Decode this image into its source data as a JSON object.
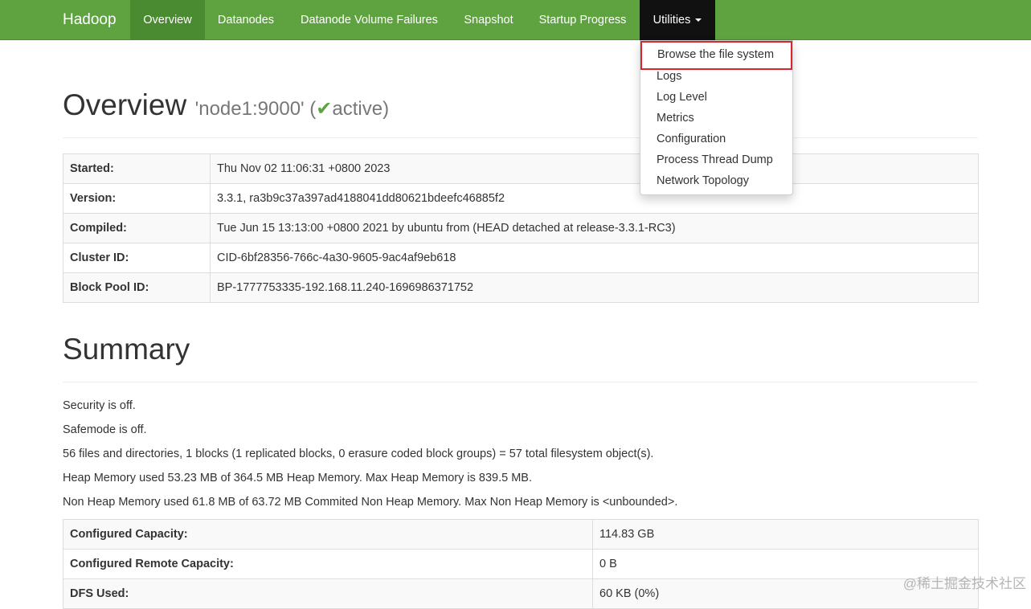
{
  "navbar": {
    "brand": "Hadoop",
    "items": [
      {
        "label": "Overview"
      },
      {
        "label": "Datanodes"
      },
      {
        "label": "Datanode Volume Failures"
      },
      {
        "label": "Snapshot"
      },
      {
        "label": "Startup Progress"
      },
      {
        "label": "Utilities"
      }
    ]
  },
  "dropdown": {
    "items": [
      {
        "label": "Browse the file system"
      },
      {
        "label": "Logs"
      },
      {
        "label": "Log Level"
      },
      {
        "label": "Metrics"
      },
      {
        "label": "Configuration"
      },
      {
        "label": "Process Thread Dump"
      },
      {
        "label": "Network Topology"
      }
    ]
  },
  "overview": {
    "title": "Overview",
    "node_prefix": "'node1:9000' (",
    "check_glyph": "✔",
    "status": "active",
    "status_suffix": ")",
    "rows": [
      {
        "key": "Started:",
        "value": "Thu Nov 02 11:06:31 +0800 2023"
      },
      {
        "key": "Version:",
        "value": "3.3.1, ra3b9c37a397ad4188041dd80621bdeefc46885f2"
      },
      {
        "key": "Compiled:",
        "value": "Tue Jun 15 13:13:00 +0800 2021 by ubuntu from (HEAD detached at release-3.3.1-RC3)"
      },
      {
        "key": "Cluster ID:",
        "value": "CID-6bf28356-766c-4a30-9605-9ac4af9eb618"
      },
      {
        "key": "Block Pool ID:",
        "value": "BP-1777753335-192.168.11.240-1696986371752"
      }
    ]
  },
  "summary": {
    "title": "Summary",
    "lines": [
      "Security is off.",
      "Safemode is off.",
      "56 files and directories, 1 blocks (1 replicated blocks, 0 erasure coded block groups) = 57 total filesystem object(s).",
      "Heap Memory used 53.23 MB of 364.5 MB Heap Memory. Max Heap Memory is 839.5 MB.",
      "Non Heap Memory used 61.8 MB of 63.72 MB Commited Non Heap Memory. Max Non Heap Memory is <unbounded>."
    ],
    "rows": [
      {
        "key": "Configured Capacity:",
        "value": "114.83 GB"
      },
      {
        "key": "Configured Remote Capacity:",
        "value": "0 B"
      },
      {
        "key": "DFS Used:",
        "value": "60 KB (0%)"
      }
    ]
  },
  "watermark": "@稀土掘金技术社区",
  "colors": {
    "navbar": "#5fa341",
    "navbar_active": "#4a8a31",
    "navbar_open": "#111111",
    "highlight_border": "#d9262d"
  }
}
